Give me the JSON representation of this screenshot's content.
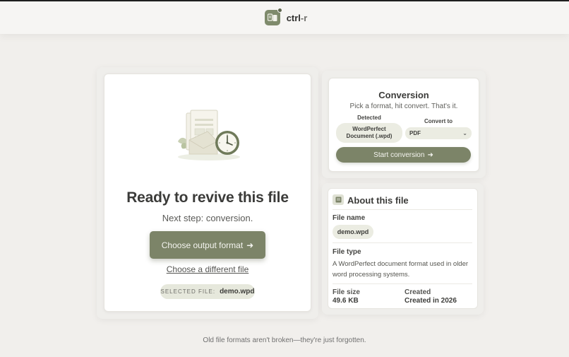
{
  "header": {
    "brand_main": "ctrl",
    "brand_accent": "-r",
    "logo_icon": "document-convert-icon"
  },
  "hero": {
    "title": "Ready to revive this file",
    "subtitle": "Next step: conversion.",
    "choose_button": "Choose output format",
    "arrow": "➜",
    "different_file_link": "Choose a different file",
    "selected_label": "SELECTED FILE:",
    "selected_value": "demo.wpd"
  },
  "conversion": {
    "title": "Conversion",
    "subtitle": "Pick a format, hit convert. That's it.",
    "detected_label": "Detected",
    "detected_value": "WordPerfect Document (.wpd)",
    "convert_to_label": "Convert to",
    "selected_format": "PDF",
    "start_button": "Start conversion",
    "arrow": "➜"
  },
  "about": {
    "title": "About this file",
    "file_name_label": "File name",
    "file_name": "demo.wpd",
    "file_type_label": "File type",
    "file_type_desc": "A WordPerfect document format used in older word processing systems.",
    "file_size_label": "File size",
    "file_size": "49.6 KB",
    "created_label": "Created",
    "created": "Created in 2026"
  },
  "footer": {
    "tagline": "Old file formats aren't broken—they're just forgotten."
  },
  "colors": {
    "accent": "#7c8468",
    "background": "#f1efec",
    "pill": "#ebece2"
  }
}
